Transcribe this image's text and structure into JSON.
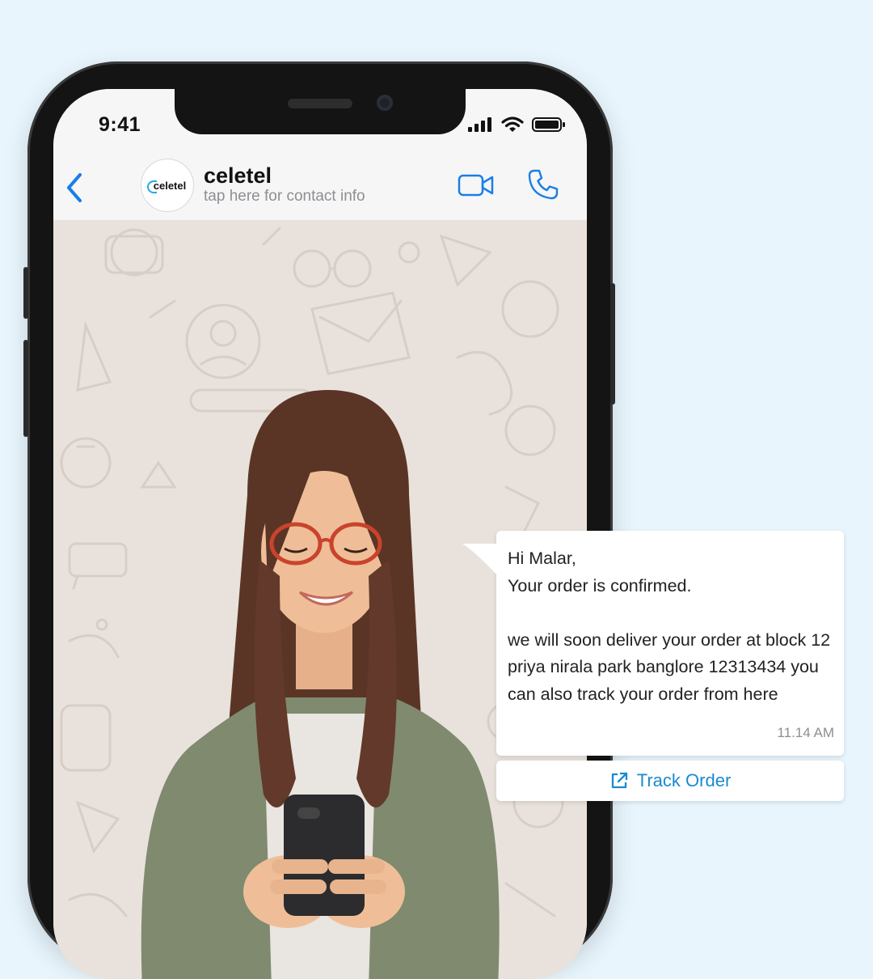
{
  "status_bar": {
    "time": "9:41"
  },
  "header": {
    "contact_name": "celetel",
    "contact_subtitle": "tap here for contact info",
    "avatar_text": "celetel"
  },
  "message": {
    "text": "Hi Malar,\nYour order is confirmed.\n\nwe will soon deliver your order at block 12 priya nirala park banglore 12313434 you can also track your order from here",
    "timestamp": "11.14 AM",
    "button_label": "Track Order"
  },
  "icons": {
    "back": "chevron-left-icon",
    "video": "video-camera-icon",
    "call": "phone-icon",
    "track": "external-link-icon"
  },
  "colors": {
    "page_background": "#e8f5fd",
    "accent_blue": "#1a8ad0",
    "chat_background": "#e9e2dc",
    "bubble": "#ffffff"
  }
}
